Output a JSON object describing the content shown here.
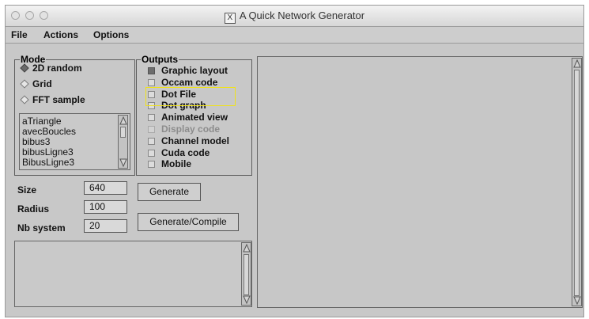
{
  "window": {
    "title": "A Quick Network Generator",
    "title_icon_glyph": "X",
    "title_icon": "x11-icon"
  },
  "menu": {
    "file": "File",
    "actions": "Actions",
    "options": "Options"
  },
  "mode": {
    "label": "Mode",
    "options": [
      {
        "label": "2D random",
        "selected": true
      },
      {
        "label": "Grid",
        "selected": false
      },
      {
        "label": "FFT sample",
        "selected": false
      }
    ],
    "list_items": [
      "aTriangle",
      "avecBoucles",
      "bibus3",
      "bibusLigne3",
      "BibusLigne3"
    ]
  },
  "outputs": {
    "label": "Outputs",
    "items": [
      {
        "label": "Graphic layout",
        "checked": true,
        "disabled": false
      },
      {
        "label": "Occam code",
        "checked": false,
        "disabled": false
      },
      {
        "label": "Dot File",
        "checked": false,
        "disabled": false
      },
      {
        "label": "Dot graph",
        "checked": false,
        "disabled": false
      },
      {
        "label": "Animated view",
        "checked": false,
        "disabled": false
      },
      {
        "label": "Display code",
        "checked": false,
        "disabled": true
      },
      {
        "label": "Channel model",
        "checked": false,
        "disabled": false
      },
      {
        "label": "Cuda code",
        "checked": false,
        "disabled": false
      },
      {
        "label": "Mobile",
        "checked": false,
        "disabled": false
      }
    ]
  },
  "params": {
    "size_label": "Size",
    "size_value": "640",
    "radius_label": "Radius",
    "radius_value": "100",
    "nb_system_label": "Nb system",
    "nb_system_value": "20"
  },
  "buttons": {
    "generate": "Generate",
    "generate_compile": "Generate/Compile"
  },
  "colors": {
    "highlight": "#f0e21a",
    "panel": "#c8c8c8"
  }
}
